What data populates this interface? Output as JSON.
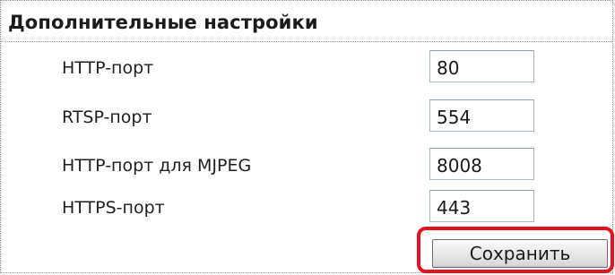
{
  "section": {
    "title": "Дополнительные настройки"
  },
  "fields": [
    {
      "label": "HTTP-порт",
      "value": "80"
    },
    {
      "label": "RTSP-порт",
      "value": "554"
    },
    {
      "label": "HTTP-порт для MJPEG",
      "value": "8008"
    },
    {
      "label": "HTTPS-порт",
      "value": "443"
    }
  ],
  "actions": {
    "save_label": "Сохранить"
  },
  "colors": {
    "highlight": "#e3141f",
    "field_border": "#a9b8c8"
  }
}
